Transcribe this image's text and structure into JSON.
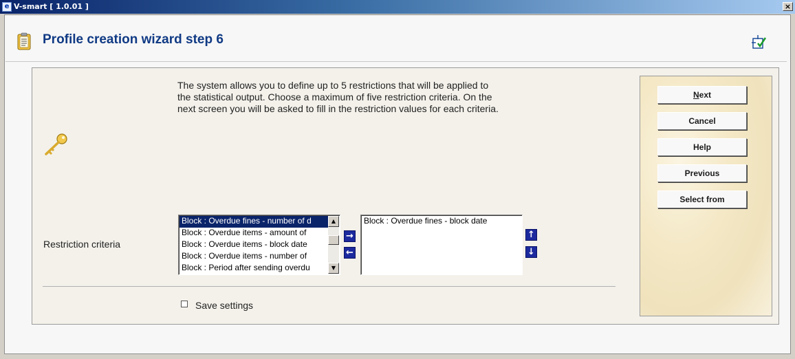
{
  "window": {
    "title": "V-smart [ 1.0.01 ]",
    "close_glyph": "×"
  },
  "page": {
    "title": "Profile creation wizard step 6"
  },
  "icons": {
    "app": "application-icon",
    "header": "clipboard-icon",
    "help": "help-context-icon",
    "key": "key-icon"
  },
  "intro_text": "The system allows you to define up to 5 restrictions that will be applied to the statistical output. Choose a maximum of five restriction criteria. On the next screen you will be asked to fill in the restriction values for each criteria.",
  "restriction": {
    "label": "Restriction criteria",
    "available": [
      "Block : Overdue fines - number of d",
      "Block : Overdue items - amount of",
      "Block : Overdue items - block date",
      "Block : Overdue items - number of",
      "Block : Period after sending overdu"
    ],
    "selected_index": 0,
    "chosen": [
      "Block : Overdue fines - block date"
    ],
    "move_right_glyph": "→",
    "move_left_glyph": "←",
    "move_up_glyph": "↑",
    "move_down_glyph": "↓"
  },
  "save_settings": {
    "label": "Save settings",
    "checked": false
  },
  "buttons": {
    "next_first": "N",
    "next_rest": "ext",
    "cancel": "Cancel",
    "help": "Help",
    "previous": "Previous",
    "select_from": "Select from"
  },
  "colors": {
    "title": "#103a84",
    "titlebar": "#0a246a",
    "selection": "#0a246a",
    "move_button": "#1c2a9e"
  }
}
